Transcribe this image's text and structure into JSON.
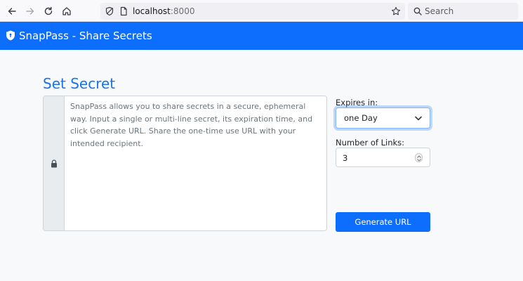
{
  "browser": {
    "url_host": "localhost",
    "url_port": ":8000",
    "search_placeholder": "Search",
    "icons": [
      "back-arrow-icon",
      "forward-arrow-icon",
      "reload-icon",
      "home-icon",
      "tracking-shield-icon",
      "page-icon",
      "bookmark-star-icon",
      "search-icon"
    ]
  },
  "navbar": {
    "brand": "SnapPass - Share Secrets",
    "icon": "shield-icon",
    "color": "#0d6efd"
  },
  "form": {
    "title": "Set Secret",
    "secret_placeholder": "SnapPass allows you to share secrets in a secure, ephemeral way. Input a single or multi-line secret, its expiration time, and click Generate URL. Share the one-time use URL with your intended recipient.",
    "lock_icon": "lock-icon",
    "expires_label": "Expires in:",
    "expires_value": "one Day",
    "links_label": "Number of Links:",
    "links_value": "3",
    "generate_label": "Generate URL"
  }
}
